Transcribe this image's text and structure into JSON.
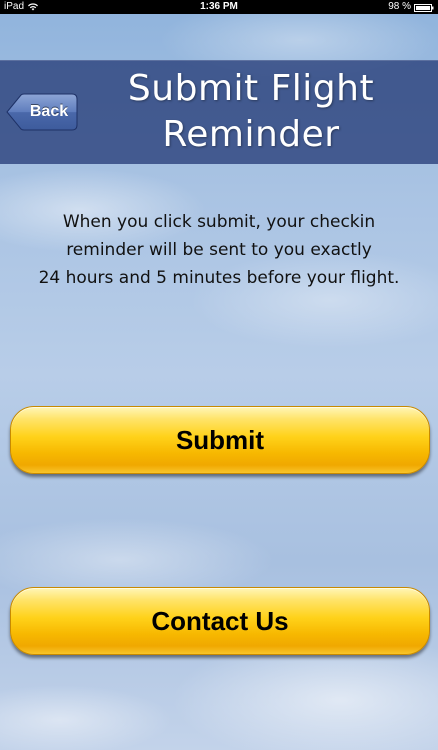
{
  "status_bar": {
    "device": "iPad",
    "time": "1:36 PM",
    "battery": "98 %"
  },
  "header": {
    "back_label": "Back",
    "title_line1": "Submit Flight",
    "title_line2": "Reminder"
  },
  "description": {
    "line1": "When you click submit, your checkin",
    "line2": "reminder will be sent to you exactly",
    "line3": "24 hours and 5 minutes before your flight."
  },
  "buttons": {
    "submit_label": "Submit",
    "contact_label": "Contact Us"
  },
  "colors": {
    "header_band": "#283e78",
    "button_yellow": "#ffd21a",
    "sky_blue": "#a9c3e3"
  },
  "icons": {
    "wifi": "wifi-icon",
    "battery": "battery-icon",
    "back": "back-arrow-icon"
  }
}
